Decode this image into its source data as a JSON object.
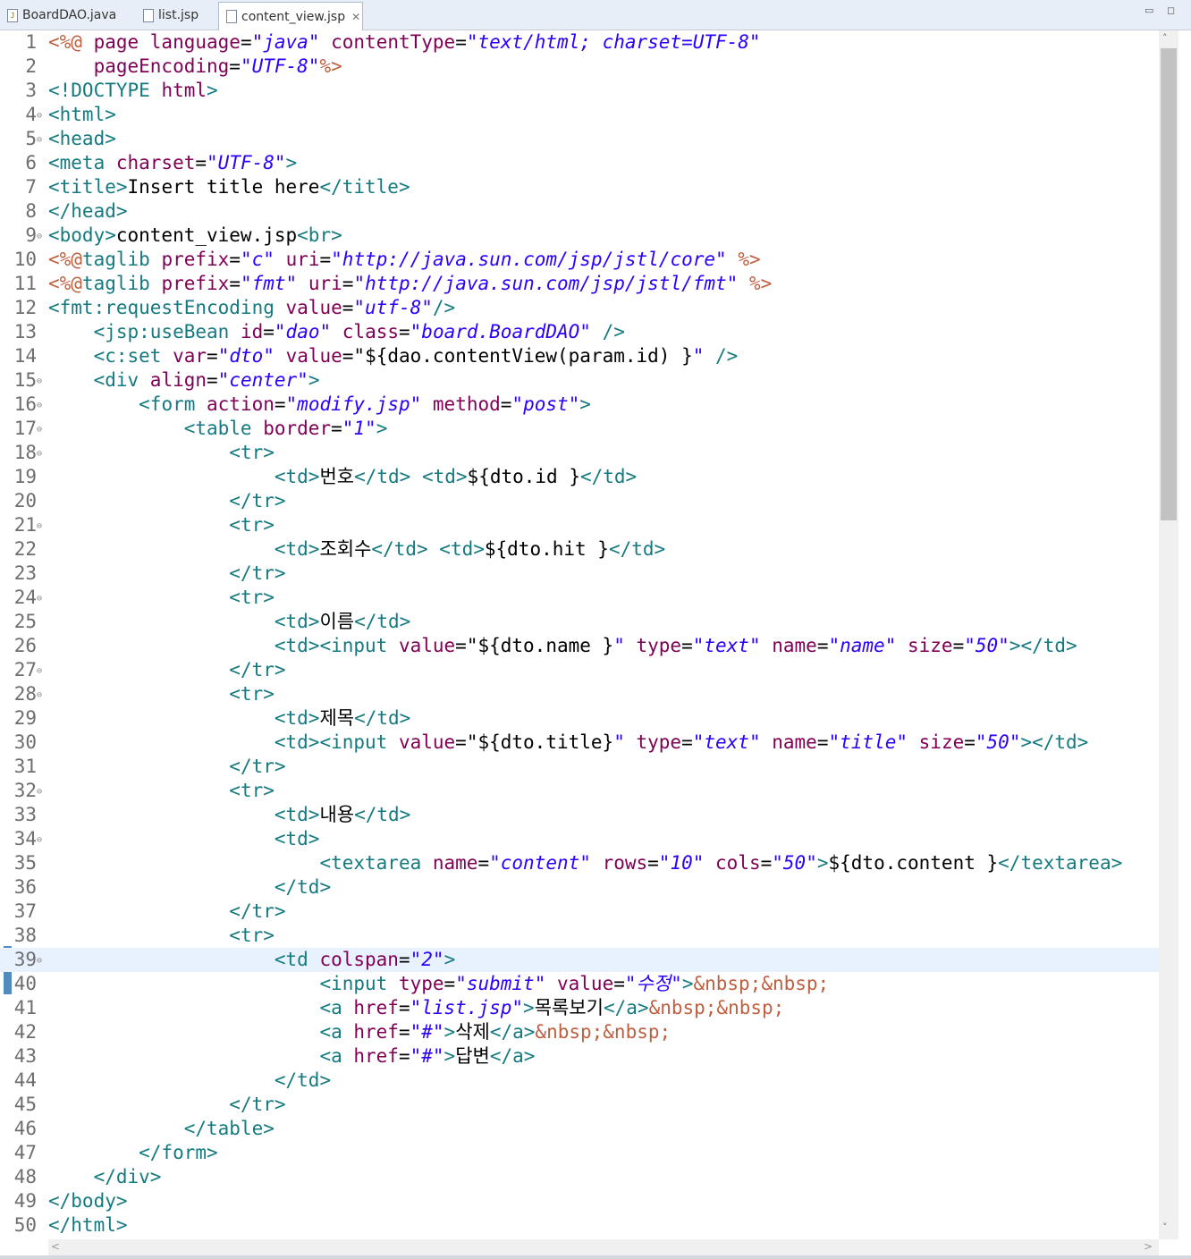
{
  "tabs": [
    {
      "label": "BoardDAO.java",
      "icon": "java-file-icon",
      "active": false
    },
    {
      "label": "list.jsp",
      "icon": "jsp-file-icon",
      "active": false
    },
    {
      "label": "content_view.jsp",
      "icon": "jsp-file-icon",
      "active": true,
      "close": "✕"
    }
  ],
  "window_controls": {
    "minimize": "▭",
    "maximize": "◻"
  },
  "current_line": 39,
  "lines": [
    {
      "n": "1",
      "fold": false,
      "code": [
        [
          "dl",
          "<%@ "
        ],
        [
          "at",
          "page language"
        ],
        [
          "",
          "="
        ],
        [
          "vl",
          "\"java\""
        ],
        [
          "",
          " "
        ],
        [
          "at",
          "contentType"
        ],
        [
          "",
          "="
        ],
        [
          "vl",
          "\"text/html; charset=UTF-8\""
        ]
      ]
    },
    {
      "n": "2",
      "fold": false,
      "code": [
        [
          "",
          "    "
        ],
        [
          "at",
          "pageEncoding"
        ],
        [
          "",
          "="
        ],
        [
          "vl",
          "\"UTF-8\""
        ],
        [
          "dl",
          "%>"
        ]
      ]
    },
    {
      "n": "3",
      "fold": false,
      "code": [
        [
          "tg",
          "<!DOCTYPE "
        ],
        [
          "at",
          "html"
        ],
        [
          "tg",
          ">"
        ]
      ]
    },
    {
      "n": "4",
      "fold": true,
      "code": [
        [
          "tg",
          "<html>"
        ]
      ]
    },
    {
      "n": "5",
      "fold": true,
      "code": [
        [
          "tg",
          "<head>"
        ]
      ]
    },
    {
      "n": "6",
      "fold": false,
      "code": [
        [
          "tg",
          "<meta "
        ],
        [
          "at",
          "charset"
        ],
        [
          "",
          "="
        ],
        [
          "vl",
          "\"UTF-8\""
        ],
        [
          "tg",
          ">"
        ]
      ]
    },
    {
      "n": "7",
      "fold": false,
      "code": [
        [
          "tg",
          "<title>"
        ],
        [
          "",
          "Insert title here"
        ],
        [
          "tg",
          "</title>"
        ]
      ]
    },
    {
      "n": "8",
      "fold": false,
      "code": [
        [
          "tg",
          "</head>"
        ]
      ]
    },
    {
      "n": "9",
      "fold": true,
      "code": [
        [
          "tg",
          "<body>"
        ],
        [
          "",
          "content_view.jsp"
        ],
        [
          "tg",
          "<br>"
        ]
      ]
    },
    {
      "n": "10",
      "fold": false,
      "code": [
        [
          "dl",
          "<%@"
        ],
        [
          "tg",
          "taglib "
        ],
        [
          "at",
          "prefix"
        ],
        [
          "",
          "="
        ],
        [
          "vl",
          "\"c\""
        ],
        [
          "",
          " "
        ],
        [
          "at",
          "uri"
        ],
        [
          "",
          "="
        ],
        [
          "vl",
          "\"http://java.sun.com/jsp/jstl/core\""
        ],
        [
          "",
          " "
        ],
        [
          "dl",
          "%>"
        ]
      ]
    },
    {
      "n": "11",
      "fold": false,
      "code": [
        [
          "dl",
          "<%@"
        ],
        [
          "tg",
          "taglib "
        ],
        [
          "at",
          "prefix"
        ],
        [
          "",
          "="
        ],
        [
          "vl",
          "\"fmt\""
        ],
        [
          "",
          " "
        ],
        [
          "at",
          "uri"
        ],
        [
          "",
          "="
        ],
        [
          "vl",
          "\"http://java.sun.com/jsp/jstl/fmt\""
        ],
        [
          "",
          " "
        ],
        [
          "dl",
          "%>"
        ]
      ]
    },
    {
      "n": "12",
      "fold": false,
      "code": [
        [
          "tg",
          "<fmt:requestEncoding "
        ],
        [
          "at",
          "value"
        ],
        [
          "",
          "="
        ],
        [
          "vl",
          "\"utf-8\""
        ],
        [
          "tg",
          "/>"
        ]
      ]
    },
    {
      "n": "13",
      "fold": false,
      "code": [
        [
          "",
          "    "
        ],
        [
          "tg",
          "<jsp:useBean "
        ],
        [
          "at",
          "id"
        ],
        [
          "",
          "="
        ],
        [
          "vl",
          "\"dao\""
        ],
        [
          "",
          " "
        ],
        [
          "at",
          "class"
        ],
        [
          "",
          "="
        ],
        [
          "vl",
          "\"board.BoardDAO\""
        ],
        [
          "",
          " "
        ],
        [
          "tg",
          "/>"
        ]
      ]
    },
    {
      "n": "14",
      "fold": false,
      "code": [
        [
          "",
          "    "
        ],
        [
          "tg",
          "<c:set "
        ],
        [
          "at",
          "var"
        ],
        [
          "",
          "="
        ],
        [
          "vl",
          "\"dto\""
        ],
        [
          "",
          " "
        ],
        [
          "at",
          "value"
        ],
        [
          "",
          "=\"${dao.contentView(param.id) }"
        ],
        [
          "vl",
          "\""
        ],
        [
          "",
          " "
        ],
        [
          "tg",
          "/>"
        ]
      ]
    },
    {
      "n": "15",
      "fold": true,
      "code": [
        [
          "",
          "    "
        ],
        [
          "tg",
          "<div "
        ],
        [
          "at",
          "align"
        ],
        [
          "",
          "="
        ],
        [
          "vl",
          "\"center\""
        ],
        [
          "tg",
          ">"
        ]
      ]
    },
    {
      "n": "16",
      "fold": true,
      "code": [
        [
          "",
          "        "
        ],
        [
          "tg",
          "<form "
        ],
        [
          "at",
          "action"
        ],
        [
          "",
          "="
        ],
        [
          "vl",
          "\"modify.jsp\""
        ],
        [
          "",
          " "
        ],
        [
          "at",
          "method"
        ],
        [
          "",
          "="
        ],
        [
          "vl",
          "\"post\""
        ],
        [
          "tg",
          ">"
        ]
      ]
    },
    {
      "n": "17",
      "fold": true,
      "code": [
        [
          "",
          "            "
        ],
        [
          "tg",
          "<table "
        ],
        [
          "at",
          "border"
        ],
        [
          "",
          "="
        ],
        [
          "vl",
          "\"1\""
        ],
        [
          "tg",
          ">"
        ]
      ]
    },
    {
      "n": "18",
      "fold": true,
      "code": [
        [
          "",
          "                "
        ],
        [
          "tg",
          "<tr>"
        ]
      ]
    },
    {
      "n": "19",
      "fold": false,
      "code": [
        [
          "",
          "                    "
        ],
        [
          "tg",
          "<td>"
        ],
        [
          "",
          "번호"
        ],
        [
          "tg",
          "</td>"
        ],
        [
          "",
          " "
        ],
        [
          "tg",
          "<td>"
        ],
        [
          "",
          "${dto.id }"
        ],
        [
          "tg",
          "</td>"
        ]
      ]
    },
    {
      "n": "20",
      "fold": false,
      "code": [
        [
          "",
          "                "
        ],
        [
          "tg",
          "</tr>"
        ]
      ]
    },
    {
      "n": "21",
      "fold": true,
      "code": [
        [
          "",
          "                "
        ],
        [
          "tg",
          "<tr>"
        ]
      ]
    },
    {
      "n": "22",
      "fold": false,
      "code": [
        [
          "",
          "                    "
        ],
        [
          "tg",
          "<td>"
        ],
        [
          "",
          "조회수"
        ],
        [
          "tg",
          "</td>"
        ],
        [
          "",
          " "
        ],
        [
          "tg",
          "<td>"
        ],
        [
          "",
          "${dto.hit }"
        ],
        [
          "tg",
          "</td>"
        ]
      ]
    },
    {
      "n": "23",
      "fold": false,
      "code": [
        [
          "",
          "                "
        ],
        [
          "tg",
          "</tr>"
        ]
      ]
    },
    {
      "n": "24",
      "fold": true,
      "code": [
        [
          "",
          "                "
        ],
        [
          "tg",
          "<tr>"
        ]
      ]
    },
    {
      "n": "25",
      "fold": false,
      "code": [
        [
          "",
          "                    "
        ],
        [
          "tg",
          "<td>"
        ],
        [
          "",
          "이름"
        ],
        [
          "tg",
          "</td>"
        ]
      ]
    },
    {
      "n": "26",
      "fold": false,
      "code": [
        [
          "",
          "                    "
        ],
        [
          "tg",
          "<td><input "
        ],
        [
          "at",
          "value"
        ],
        [
          "",
          "=\"${dto.name }"
        ],
        [
          "vl",
          "\""
        ],
        [
          "",
          " "
        ],
        [
          "at",
          "type"
        ],
        [
          "",
          "="
        ],
        [
          "vl",
          "\"text\""
        ],
        [
          "",
          " "
        ],
        [
          "at",
          "name"
        ],
        [
          "",
          "="
        ],
        [
          "vl",
          "\"name\""
        ],
        [
          "",
          " "
        ],
        [
          "at",
          "size"
        ],
        [
          "",
          "="
        ],
        [
          "vl",
          "\"50\""
        ],
        [
          "tg",
          "></td>"
        ]
      ]
    },
    {
      "n": "27",
      "fold": true,
      "code": [
        [
          "",
          "                "
        ],
        [
          "tg",
          "</tr>"
        ]
      ]
    },
    {
      "n": "28",
      "fold": true,
      "code": [
        [
          "",
          "                "
        ],
        [
          "tg",
          "<tr>"
        ]
      ]
    },
    {
      "n": "29",
      "fold": false,
      "code": [
        [
          "",
          "                    "
        ],
        [
          "tg",
          "<td>"
        ],
        [
          "",
          "제목"
        ],
        [
          "tg",
          "</td>"
        ]
      ]
    },
    {
      "n": "30",
      "fold": false,
      "code": [
        [
          "",
          "                    "
        ],
        [
          "tg",
          "<td><input "
        ],
        [
          "at",
          "value"
        ],
        [
          "",
          "=\"${dto.title}"
        ],
        [
          "vl",
          "\""
        ],
        [
          "",
          " "
        ],
        [
          "at",
          "type"
        ],
        [
          "",
          "="
        ],
        [
          "vl",
          "\"text\""
        ],
        [
          "",
          " "
        ],
        [
          "at",
          "name"
        ],
        [
          "",
          "="
        ],
        [
          "vl",
          "\"title\""
        ],
        [
          "",
          " "
        ],
        [
          "at",
          "size"
        ],
        [
          "",
          "="
        ],
        [
          "vl",
          "\"50\""
        ],
        [
          "tg",
          "></td>"
        ]
      ]
    },
    {
      "n": "31",
      "fold": false,
      "code": [
        [
          "",
          "                "
        ],
        [
          "tg",
          "</tr>"
        ]
      ]
    },
    {
      "n": "32",
      "fold": true,
      "code": [
        [
          "",
          "                "
        ],
        [
          "tg",
          "<tr>"
        ]
      ]
    },
    {
      "n": "33",
      "fold": false,
      "code": [
        [
          "",
          "                    "
        ],
        [
          "tg",
          "<td>"
        ],
        [
          "",
          "내용"
        ],
        [
          "tg",
          "</td>"
        ]
      ]
    },
    {
      "n": "34",
      "fold": true,
      "code": [
        [
          "",
          "                    "
        ],
        [
          "tg",
          "<td>"
        ]
      ]
    },
    {
      "n": "35",
      "fold": false,
      "code": [
        [
          "",
          "                        "
        ],
        [
          "tg",
          "<textarea "
        ],
        [
          "at",
          "name"
        ],
        [
          "",
          "="
        ],
        [
          "vl",
          "\"content\""
        ],
        [
          "",
          " "
        ],
        [
          "at",
          "rows"
        ],
        [
          "",
          "="
        ],
        [
          "vl",
          "\"10\""
        ],
        [
          "",
          " "
        ],
        [
          "at",
          "cols"
        ],
        [
          "",
          "="
        ],
        [
          "vl",
          "\"50\""
        ],
        [
          "tg",
          ">"
        ],
        [
          "",
          "${dto.content }"
        ],
        [
          "tg",
          "</textarea>"
        ]
      ]
    },
    {
      "n": "36",
      "fold": false,
      "code": [
        [
          "",
          "                    "
        ],
        [
          "tg",
          "</td>"
        ]
      ]
    },
    {
      "n": "37",
      "fold": false,
      "code": [
        [
          "",
          "                "
        ],
        [
          "tg",
          "</tr>"
        ]
      ]
    },
    {
      "n": "38",
      "fold": false,
      "code": [
        [
          "",
          "                "
        ],
        [
          "tg",
          "<tr>"
        ]
      ]
    },
    {
      "n": "39",
      "fold": true,
      "code": [
        [
          "",
          "                    "
        ],
        [
          "tg",
          "<td "
        ],
        [
          "at",
          "colspan"
        ],
        [
          "",
          "="
        ],
        [
          "vl",
          "\"2\""
        ],
        [
          "tg",
          ">"
        ]
      ]
    },
    {
      "n": "40",
      "fold": false,
      "code": [
        [
          "",
          "                        "
        ],
        [
          "tg",
          "<input "
        ],
        [
          "at",
          "type"
        ],
        [
          "",
          "="
        ],
        [
          "vl",
          "\"submit\""
        ],
        [
          "",
          " "
        ],
        [
          "at",
          "value"
        ],
        [
          "",
          "="
        ],
        [
          "vl",
          "\"수정\""
        ],
        [
          "tg",
          ">"
        ],
        [
          "dl",
          "&nbsp;&nbsp;"
        ]
      ]
    },
    {
      "n": "41",
      "fold": false,
      "code": [
        [
          "",
          "                        "
        ],
        [
          "tg",
          "<a "
        ],
        [
          "at",
          "href"
        ],
        [
          "",
          "="
        ],
        [
          "vl",
          "\"list.jsp\""
        ],
        [
          "tg",
          ">"
        ],
        [
          "",
          "목록보기"
        ],
        [
          "tg",
          "</a>"
        ],
        [
          "dl",
          "&nbsp;&nbsp;"
        ]
      ]
    },
    {
      "n": "42",
      "fold": false,
      "code": [
        [
          "",
          "                        "
        ],
        [
          "tg",
          "<a "
        ],
        [
          "at",
          "href"
        ],
        [
          "",
          "="
        ],
        [
          "vl",
          "\"#\""
        ],
        [
          "tg",
          ">"
        ],
        [
          "",
          "삭제"
        ],
        [
          "tg",
          "</a>"
        ],
        [
          "dl",
          "&nbsp;&nbsp;"
        ]
      ]
    },
    {
      "n": "43",
      "fold": false,
      "code": [
        [
          "",
          "                        "
        ],
        [
          "tg",
          "<a "
        ],
        [
          "at",
          "href"
        ],
        [
          "",
          "="
        ],
        [
          "vl",
          "\"#\""
        ],
        [
          "tg",
          ">"
        ],
        [
          "",
          "답변"
        ],
        [
          "tg",
          "</a>"
        ]
      ]
    },
    {
      "n": "44",
      "fold": false,
      "code": [
        [
          "",
          "                    "
        ],
        [
          "tg",
          "</td>"
        ]
      ]
    },
    {
      "n": "45",
      "fold": false,
      "code": [
        [
          "",
          "                "
        ],
        [
          "tg",
          "</tr>"
        ]
      ]
    },
    {
      "n": "46",
      "fold": false,
      "code": [
        [
          "",
          "            "
        ],
        [
          "tg",
          "</table>"
        ]
      ]
    },
    {
      "n": "47",
      "fold": false,
      "code": [
        [
          "",
          "        "
        ],
        [
          "tg",
          "</form>"
        ]
      ]
    },
    {
      "n": "48",
      "fold": false,
      "code": [
        [
          "",
          "    "
        ],
        [
          "tg",
          "</div>"
        ]
      ]
    },
    {
      "n": "49",
      "fold": false,
      "code": [
        [
          "tg",
          "</body>"
        ]
      ]
    },
    {
      "n": "50",
      "fold": false,
      "code": [
        [
          "tg",
          "</html>"
        ]
      ]
    }
  ],
  "scroll": {
    "up": "˄",
    "down": "˅",
    "left": "<",
    "right": ">"
  }
}
